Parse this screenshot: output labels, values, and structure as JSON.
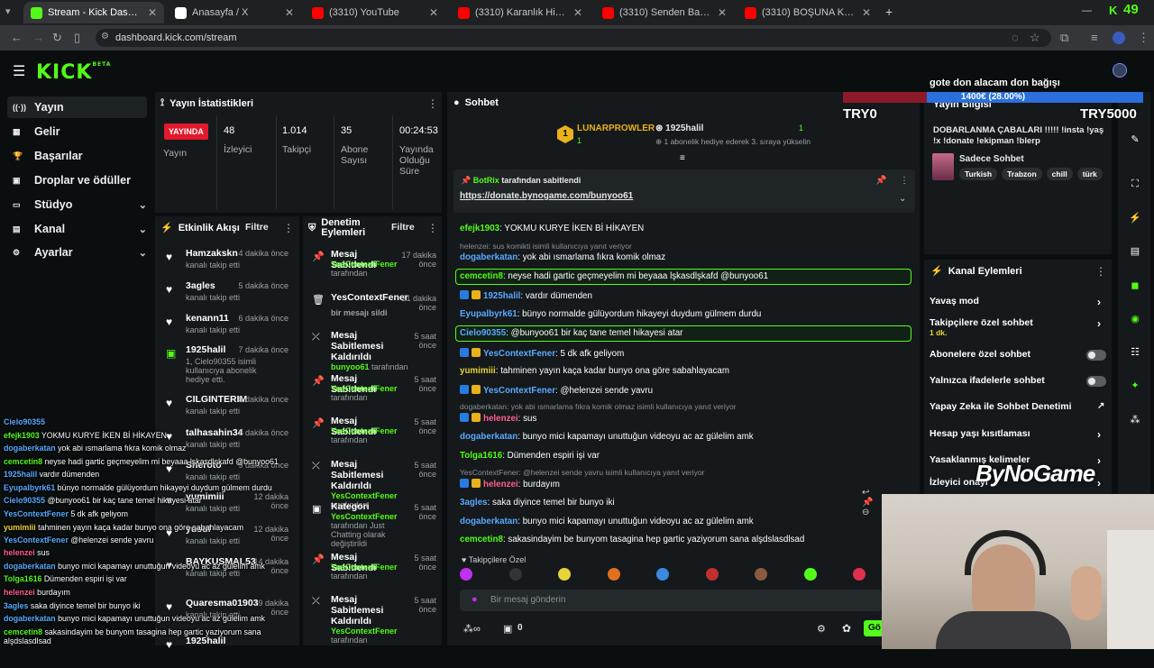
{
  "browser": {
    "tabs": [
      {
        "title": "Stream - Kick Dashboard",
        "color": "#53fc18"
      },
      {
        "title": "Anasayfa / X",
        "color": "#ffffff"
      },
      {
        "title": "(3310) YouTube",
        "color": "#ff0000"
      },
      {
        "title": "(3310) Karanlık Hikayeler: Harp...",
        "color": "#ff0000"
      },
      {
        "title": "(3310) Senden Bahsetti #1 - Yo...",
        "color": "#ff0000"
      },
      {
        "title": "(3310) BOŞUNA KAYDIRMA 55/...",
        "color": "#ff0000"
      }
    ],
    "url": "dashboard.kick.com/stream",
    "clock": "49"
  },
  "brand": {
    "logo": "KICK",
    "beta": "BETA",
    "accent": "#53fc18"
  },
  "sidebar": {
    "items": [
      {
        "label": "Yayın",
        "icon": "broadcast-icon"
      },
      {
        "label": "Gelir",
        "icon": "revenue-icon"
      },
      {
        "label": "Başarılar",
        "icon": "trophy-icon"
      },
      {
        "label": "Droplar ve ödüller",
        "icon": "gift-icon"
      },
      {
        "label": "Stüdyo",
        "icon": "studio-icon"
      },
      {
        "label": "Kanal",
        "icon": "channel-icon"
      },
      {
        "label": "Ayarlar",
        "icon": "gear-icon"
      }
    ]
  },
  "stats": {
    "title": "Yayın İstatistikleri",
    "live": "YAYINDA",
    "live_label": "Yayın",
    "viewers": "48",
    "viewers_label": "İzleyici",
    "followers": "1.014",
    "followers_label": "Takipçi",
    "subs": "35",
    "subs_label": "Abone Sayısı",
    "uptime": "00:24:53",
    "uptime_label": "Yayında Olduğu Süre"
  },
  "activity": {
    "title": "Etkinlik Akışı",
    "filter": "Filtre",
    "items": [
      {
        "name": "Hamzakskn",
        "action": "kanalı takip etti",
        "ago": "4 dakika önce"
      },
      {
        "name": "3agles",
        "action": "kanalı takip etti",
        "ago": "5 dakika önce"
      },
      {
        "name": "kenann11",
        "action": "kanalı takip etti",
        "ago": "6 dakika önce"
      },
      {
        "name": "1925halil",
        "action": "1, Cielo90355 isimli kullanıcıya abonelik hediye etti.",
        "ago": "7 dakika önce"
      },
      {
        "name": "CILGINTERIM",
        "action": "kanalı takip etti",
        "ago": "8 dakika önce"
      },
      {
        "name": "talhasahin34",
        "action": "kanalı takip etti",
        "ago": "8 dakika önce"
      },
      {
        "name": "Sheroto",
        "action": "kanalı takip etti",
        "ago": "9 dakika önce"
      },
      {
        "name": "yumimiii",
        "action": "kanalı takip etti",
        "ago": "12 dakika önce"
      },
      {
        "name": "yusuf",
        "action": "kanalı takip etti",
        "ago": "12 dakika önce"
      },
      {
        "name": "BAYKUSMAL53",
        "action": "kanalı takip etti",
        "ago": "14 dakika önce"
      },
      {
        "name": "Quaresma01903",
        "action": "kanalı takip etti",
        "ago": "19 dakika önce"
      },
      {
        "name": "1925halil",
        "action": "",
        "ago": ""
      }
    ]
  },
  "moderation": {
    "title": "Denetim Eylemleri",
    "filter": "Filtre",
    "items": [
      {
        "name": "Mesaj Sabitlendi",
        "by": "YesContextFener",
        "suffix": "tarafından",
        "ago": "17 dakika önce",
        "icon": "pin-icon"
      },
      {
        "name": "YesContextFener",
        "by": "bir mesajı sildi",
        "suffix": "",
        "ago": "21 dakika önce",
        "icon": "trash-icon"
      },
      {
        "name": "Mesaj Sabitlemesi Kaldırıldı",
        "by": "bunyoo61",
        "suffix": "tarafından",
        "ago": "5 saat önce",
        "icon": "unpin-icon"
      },
      {
        "name": "Mesaj Sabitlendi",
        "by": "YesContextFener",
        "suffix": "tarafından",
        "ago": "5 saat önce",
        "icon": "pin-icon"
      },
      {
        "name": "Mesaj Sabitlendi",
        "by": "YesContextFener",
        "suffix": "tarafından",
        "ago": "5 saat önce",
        "icon": "pin-icon"
      },
      {
        "name": "Mesaj Sabitlemesi Kaldırıldı",
        "by": "YesContextFener",
        "suffix": "tarafından",
        "ago": "5 saat önce",
        "icon": "unpin-icon"
      },
      {
        "name": "Kategori",
        "by": "YesContextFener",
        "suffix": "tarafından Just Chatting olarak değiştirildi",
        "ago": "5 saat önce",
        "icon": "category-icon"
      },
      {
        "name": "Mesaj Sabitlendi",
        "by": "YesContextFener",
        "suffix": "tarafından",
        "ago": "5 saat önce",
        "icon": "pin-icon"
      },
      {
        "name": "Mesaj Sabitlemesi Kaldırıldı",
        "by": "YesContextFener",
        "suffix": "tarafından",
        "ago": "5 saat önce",
        "icon": "unpin-icon"
      }
    ]
  },
  "chat": {
    "title": "Sohbet",
    "leader1": {
      "rank": "1",
      "name": "LUNARPROWLER",
      "count": "1"
    },
    "leader2": {
      "name": "1925halil",
      "count": "1",
      "note": "1 abonelik hediye ederek 3. sıraya yükselin"
    },
    "pinned_by": "BotRix",
    "pinned_suffix": "tarafından sabitlendi",
    "pinned_link": "https://donate.bynogame.com/bunyoo61",
    "messages": [
      {
        "type": "msg",
        "user": "efejk1903",
        "color": "#53fc18",
        "text": "YOKMU KURYE İKEN Bİ HİKAYEN"
      },
      {
        "type": "reply",
        "text": "helenzei: sus komikti isimli kullanıcıya yanıt veriyor"
      },
      {
        "type": "msg",
        "user": "dogaberkatan",
        "color": "#5aa9ff",
        "text": "yok abi ısmarlama fıkra komik olmaz"
      },
      {
        "type": "hl",
        "user": "cemcetin8",
        "color": "#53fc18",
        "text": "neyse hadi gartic geçmeyelim mi beyaaa lşkasdlşkafd @bunyoo61"
      },
      {
        "type": "msg",
        "user": "1925halil",
        "color": "#5aa9ff",
        "text": "vardır dümenden"
      },
      {
        "type": "msg",
        "user": "Eyupalbyrk61",
        "color": "#5aa9ff",
        "text": "bünyo normalde gülüyordum hikayeyi duydum gülmem durdu"
      },
      {
        "type": "hl",
        "user": "Cielo90355",
        "color": "#5aa9ff",
        "text": "@bunyoo61 bir kaç tane temel hikayesi atar"
      },
      {
        "type": "msg",
        "user": "YesContextFener",
        "color": "#5aa9ff",
        "text": "5 dk afk geliyom"
      },
      {
        "type": "msg",
        "user": "yumimiii",
        "color": "#e9d33a",
        "text": "tahminen yayın kaça kadar bunyo ona göre sabahlayacam"
      },
      {
        "type": "msg",
        "user": "YesContextFener",
        "color": "#5aa9ff",
        "text": "@helenzei sende yavru"
      },
      {
        "type": "reply",
        "text": "dogaberkatan: yok abi ısmarlama fıkra komik olmaz isimli kullanıcıya yanıt veriyor"
      },
      {
        "type": "msg",
        "user": "helenzei",
        "color": "#ff5d8f",
        "text": "sus"
      },
      {
        "type": "msg",
        "user": "dogaberkatan",
        "color": "#5aa9ff",
        "text": "bunyo mici kapamayı unuttuğun videoyu ac az gülelim amk"
      },
      {
        "type": "msg",
        "user": "Tolga1616",
        "color": "#53fc18",
        "text": "Dümenden espiri işi var"
      },
      {
        "type": "reply",
        "text": "YesContextFener: @helenzei sende yavru isimli kullanıcıya yanıt veriyor"
      },
      {
        "type": "msg",
        "user": "helenzei",
        "color": "#ff5d8f",
        "text": "burdayım"
      },
      {
        "type": "msg",
        "user": "3agles",
        "color": "#5aa9ff",
        "text": "saka diyince temel bir bunyo iki"
      },
      {
        "type": "msg",
        "user": "dogaberkatan",
        "color": "#5aa9ff",
        "text": "bunyo mici kapamayı unuttuğun videoyu ac az gülelim amk"
      },
      {
        "type": "msg",
        "user": "cemcetin8",
        "color": "#53fc18",
        "text": "sakasindayim be bunyom tasagina hep gartic yaziyorum sana alşdslasdlsad"
      }
    ],
    "followers_only": "Takipçilere Özel",
    "input_placeholder": "Bir mesaj gönderin",
    "points": "0",
    "send": "Gö"
  },
  "overlay": {
    "goal_title": "gote don alacam don bağışı",
    "goal_amount": "1400€ (28.00%)",
    "goal_progress": 0.28,
    "goal_left": "TRY0",
    "goal_right": "TRY5000",
    "bynogame": "ByNoGame",
    "chat": [
      {
        "user": "Cielo90355",
        "color": "#5aa9ff",
        "text": ""
      },
      {
        "user": "efejk1903",
        "color": "#53fc18",
        "text": "YOKMU KURYE İKEN Bİ HİKAYEN"
      },
      {
        "user": "dogaberkatan",
        "color": "#5aa9ff",
        "text": "yok abi ısmarlama fıkra komik olmaz"
      },
      {
        "user": "cemcetin8",
        "color": "#53fc18",
        "text": "neyse hadi gartic geçmeyelim mi beyaaa lşkasdlşkafd @bunyoo61"
      },
      {
        "user": "1925halil",
        "color": "#5aa9ff",
        "text": "vardır dümenden"
      },
      {
        "user": "Eyupalbyrk61",
        "color": "#5aa9ff",
        "text": "bünyo normalde gülüyordum hikayeyi duydum gülmem durdu"
      },
      {
        "user": "Cielo90355",
        "color": "#5aa9ff",
        "text": "@bunyoo61 bir kaç tane temel hikayesi atar"
      },
      {
        "user": "YesContextFener",
        "color": "#5aa9ff",
        "text": "5 dk afk geliyom"
      },
      {
        "user": "yumimiii",
        "color": "#e9d33a",
        "text": "tahminen yayın kaça kadar bunyo ona göre sabahlayacam"
      },
      {
        "user": "YesContextFener",
        "color": "#5aa9ff",
        "text": "@helenzei sende yavru"
      },
      {
        "user": "helenzei",
        "color": "#ff5d8f",
        "text": "sus"
      },
      {
        "user": "dogaberkatan",
        "color": "#5aa9ff",
        "text": "bunyo mici kapamayı unuttuğun videoyu ac az gülelim amk"
      },
      {
        "user": "Tolga1616",
        "color": "#53fc18",
        "text": "Dümenden espiri işi var"
      },
      {
        "user": "helenzei",
        "color": "#ff5d8f",
        "text": "burdayım"
      },
      {
        "user": "3agles",
        "color": "#5aa9ff",
        "text": "saka diyince temel bir bunyo iki"
      },
      {
        "user": "dogaberkatan",
        "color": "#5aa9ff",
        "text": "bunyo mici kapamayı unuttuğun videoyu ac az gülelim amk"
      },
      {
        "user": "cemcetin8",
        "color": "#53fc18",
        "text": "sakasindayim be bunyom tasagina hep gartic yaziyorum sana alşdslasdlsad"
      }
    ]
  },
  "stream_info": {
    "title": "Yayın Bilgisi",
    "stream_title": "DOBARLANMA ÇABALARI !!!!! !insta !yaş !x !donate !ekipman !blerp",
    "category": "Sadece Sohbet",
    "tags": [
      "Turkish",
      "Trabzon",
      "chill",
      "türk"
    ]
  },
  "channel_actions": {
    "title": "Kanal Eylemleri",
    "items": [
      {
        "label": "Yavaş mod",
        "sub": "",
        "control": "chevron"
      },
      {
        "label": "Takipçilere özel sohbet",
        "sub": "1 dk.",
        "control": "chevron"
      },
      {
        "label": "Abonelere özel sohbet",
        "sub": "",
        "control": "toggle"
      },
      {
        "label": "Yalnızca ifadelerle sohbet",
        "sub": "",
        "control": "toggle"
      },
      {
        "label": "Yapay Zeka ile Sohbet Denetimi",
        "sub": "",
        "control": "external"
      },
      {
        "label": "Hesap yaşı kısıtlaması",
        "sub": "",
        "control": "chevron"
      },
      {
        "label": "Yasaklanmış kelimeler",
        "sub": "",
        "control": "chevron"
      },
      {
        "label": "İzleyici onayı",
        "sub": "",
        "control": "chevron"
      }
    ]
  }
}
